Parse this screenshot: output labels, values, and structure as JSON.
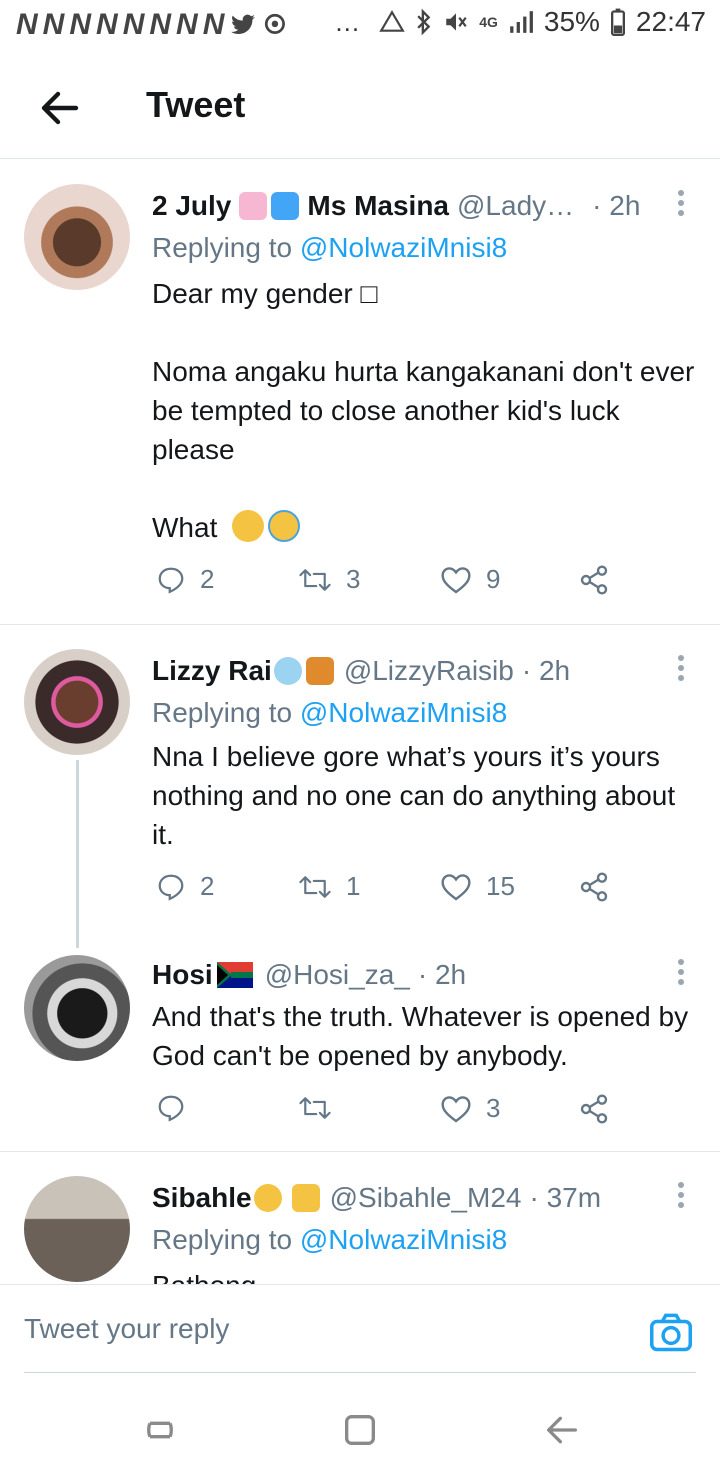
{
  "status_bar": {
    "left_icons": [
      "N",
      "N",
      "N",
      "N",
      "N",
      "N",
      "N",
      "N"
    ],
    "dots": "…",
    "network": "4G",
    "battery": "35%",
    "time": "22:47"
  },
  "header": {
    "title": "Tweet"
  },
  "tweets": [
    {
      "name_prefix": "2 July",
      "name": "Ms Masina",
      "handle": "@Lady…",
      "time": "· 2h",
      "replying_label": "Replying to",
      "replying_to": "@NolwaziMnisi8",
      "body": "Dear my gender □\n\nNoma angaku hurta kangakanani don't ever be tempted to close another kid's luck please\n\nWhat",
      "replies": "2",
      "retweets": "3",
      "likes": "9"
    },
    {
      "name": "Lizzy Rai",
      "handle": "@LizzyRaisib",
      "time": "· 2h",
      "replying_label": "Replying to",
      "replying_to": "@NolwaziMnisi8",
      "body": "Nna I believe gore what’s yours it’s yours nothing and no one can do anything about it.",
      "replies": "2",
      "retweets": "1",
      "likes": "15"
    },
    {
      "name": "Hosi",
      "handle": "@Hosi_za_",
      "time": "· 2h",
      "body": "And that's the truth. Whatever is opened by God can't be opened by anybody.",
      "replies": "",
      "retweets": "",
      "likes": "3"
    },
    {
      "name": "Sibahle",
      "handle": "@Sibahle_M24",
      "time": "· 37m",
      "replying_label": "Replying to",
      "replying_to": "@NolwaziMnisi8",
      "body": "Bathong"
    }
  ],
  "reply_bar": {
    "placeholder": "Tweet your reply"
  },
  "colors": {
    "accent": "#1da1f2",
    "text": "#14171a",
    "secondary": "#657786",
    "divider": "#e1e8ed"
  },
  "icons": [
    "back-arrow-icon",
    "reply-icon",
    "retweet-icon",
    "like-icon",
    "share-icon",
    "more-icon",
    "camera-icon",
    "recent-apps-icon",
    "home-icon",
    "back-nav-icon"
  ]
}
